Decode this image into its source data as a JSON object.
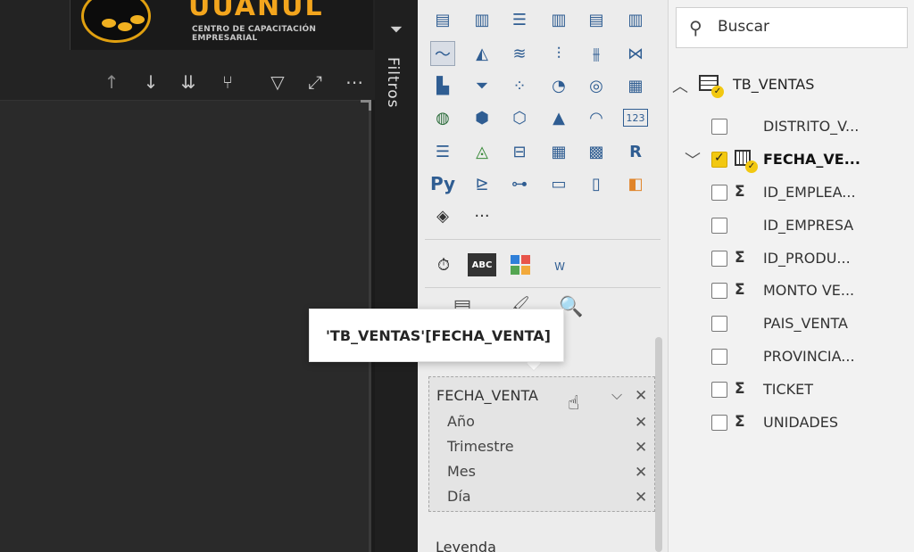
{
  "logo": {
    "wordmark": "UUANUL",
    "subtitle": "CENTRO DE CAPACITACIÓN EMPRESARIAL"
  },
  "visual_toolbar": {
    "icons": [
      "arrow-up-icon",
      "arrow-down-icon",
      "double-arrow-down-icon",
      "expand-hierarchy-icon",
      "filter-icon",
      "focus-mode-icon",
      "more-options-icon"
    ]
  },
  "filters_pane": {
    "label": "Filtros"
  },
  "visualizations": {
    "custom_visual_text": {
      "abc": "ABC",
      "word": "W"
    },
    "r_label": "R",
    "py_label": "Py",
    "more": "···",
    "tooltip": "'TB_VENTAS'[FECHA_VENTA]",
    "well": {
      "title": "FECHA_VENTA",
      "levels": [
        "Año",
        "Trimestre",
        "Mes",
        "Día"
      ]
    },
    "next_section": "Leyenda"
  },
  "fields_pane": {
    "search_placeholder": "Buscar",
    "table": {
      "name": "TB_VENTAS",
      "fields": [
        {
          "name": "DISTRITO_V...",
          "checked": false,
          "sigma": false,
          "bold": false
        },
        {
          "name": "FECHA_VE...",
          "checked": true,
          "sigma": false,
          "bold": true,
          "calendar": true
        },
        {
          "name": "ID_EMPLEA...",
          "checked": false,
          "sigma": true,
          "bold": false
        },
        {
          "name": "ID_EMPRESA",
          "checked": false,
          "sigma": false,
          "bold": false
        },
        {
          "name": "ID_PRODU...",
          "checked": false,
          "sigma": true,
          "bold": false
        },
        {
          "name": "MONTO VE...",
          "checked": false,
          "sigma": true,
          "bold": false
        },
        {
          "name": "PAIS_VENTA",
          "checked": false,
          "sigma": false,
          "bold": false
        },
        {
          "name": "PROVINCIA...",
          "checked": false,
          "sigma": false,
          "bold": false
        },
        {
          "name": "TICKET",
          "checked": false,
          "sigma": true,
          "bold": false
        },
        {
          "name": "UNIDADES",
          "checked": false,
          "sigma": true,
          "bold": false
        }
      ]
    },
    "sigma_symbol": "Σ"
  },
  "colors": {
    "accent_yellow": "#f2c811",
    "viz_blue": "#2f5d92",
    "logo_orange": "#f3a51d"
  }
}
